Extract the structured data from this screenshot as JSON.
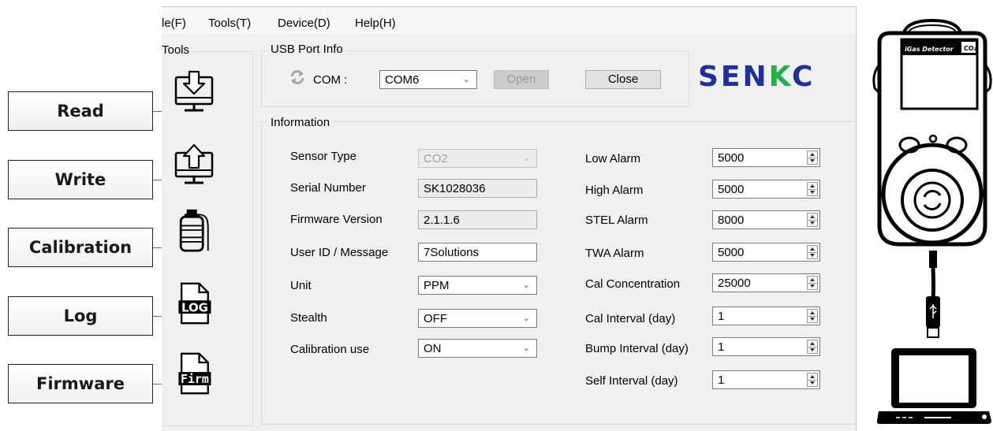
{
  "callouts": {
    "read": "Read",
    "write": "Write",
    "calibration": "Calibration",
    "log": "Log",
    "firmware": "Firmware"
  },
  "menu": {
    "file": "le(F)",
    "tools": "Tools(T)",
    "device": "Device(D)",
    "help": "Help(H)"
  },
  "tools_panel": {
    "title": "Tools",
    "log_icon_text": "LOG",
    "firm_icon_text": "Firm"
  },
  "usb": {
    "title": "USB Port Info",
    "com_label": "COM :",
    "com_value": "COM6",
    "open_label": "Open",
    "close_label": "Close"
  },
  "brand": {
    "logo_a": "SEN",
    "logo_k": "K",
    "logo_b": "C"
  },
  "info": {
    "title": "Information",
    "left": [
      {
        "label": "Sensor Type",
        "value": "CO2",
        "kind": "combo",
        "disabled": true
      },
      {
        "label": "Serial Number",
        "value": "SK1028036",
        "kind": "readonly"
      },
      {
        "label": "Firmware Version",
        "value": "2.1.1.6",
        "kind": "readonly"
      },
      {
        "label": "User ID / Message",
        "value": "7Solutions",
        "kind": "text"
      },
      {
        "label": "Unit",
        "value": "PPM",
        "kind": "combo"
      },
      {
        "label": "Stealth",
        "value": "OFF",
        "kind": "combo"
      },
      {
        "label": "Calibration use",
        "value": "ON",
        "kind": "combo"
      }
    ],
    "right": [
      {
        "label": "Low Alarm",
        "value": "5000"
      },
      {
        "label": "High Alarm",
        "value": "5000"
      },
      {
        "label": "STEL Alarm",
        "value": "8000"
      },
      {
        "label": "TWA Alarm",
        "value": "5000"
      },
      {
        "label": "Cal Concentration",
        "value": "25000"
      },
      {
        "label": "Cal Interval (day)",
        "value": "1"
      },
      {
        "label": "Bump Interval (day)",
        "value": "1"
      },
      {
        "label": "Self Interval (day)",
        "value": "1"
      }
    ]
  },
  "device": {
    "brand_text": "iGas Detector",
    "gas_text": "CO₂"
  },
  "colors": {
    "callout_line": "#3a78c2",
    "logo_blue": "#1f2f9e",
    "logo_green": "#23b04a"
  }
}
